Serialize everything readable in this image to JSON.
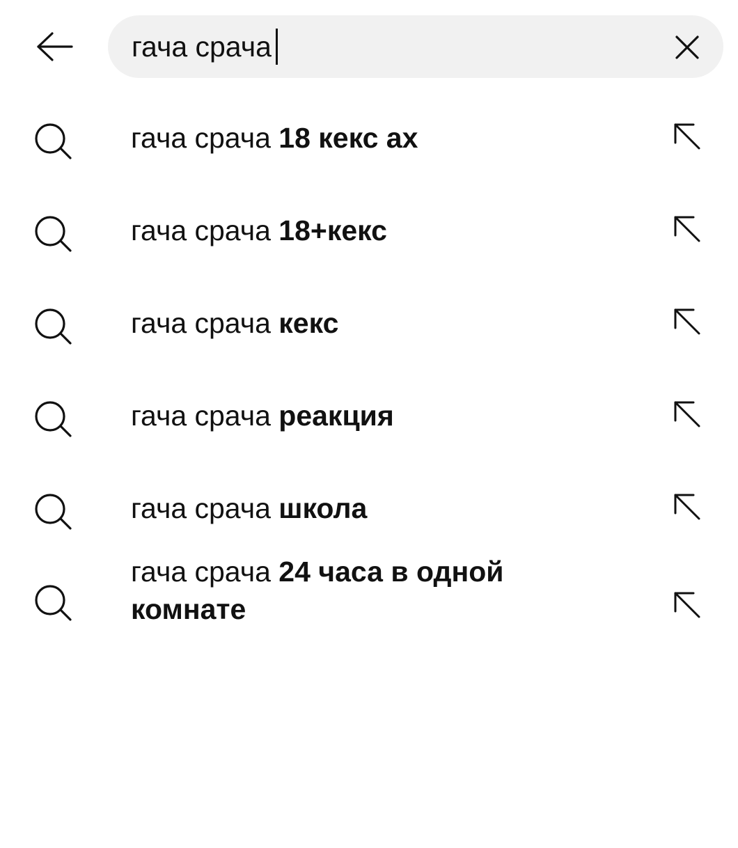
{
  "search": {
    "query": "гача срача",
    "back_icon": "arrow-left-icon",
    "clear_icon": "close-icon"
  },
  "suggestions": [
    {
      "prefix": "гача срача ",
      "completion": "18 кекс ах"
    },
    {
      "prefix": "гача срача ",
      "completion": "18+кекс"
    },
    {
      "prefix": "гача срача ",
      "completion": "кекс"
    },
    {
      "prefix": "гача срача ",
      "completion": "реакция"
    },
    {
      "prefix": "гача срача ",
      "completion": "школа"
    },
    {
      "prefix": "гача срача ",
      "completion": "24 часа в одной комнате"
    }
  ],
  "icons": {
    "suggestion_icon": "search-icon",
    "fill_icon": "arrow-up-left-icon"
  }
}
